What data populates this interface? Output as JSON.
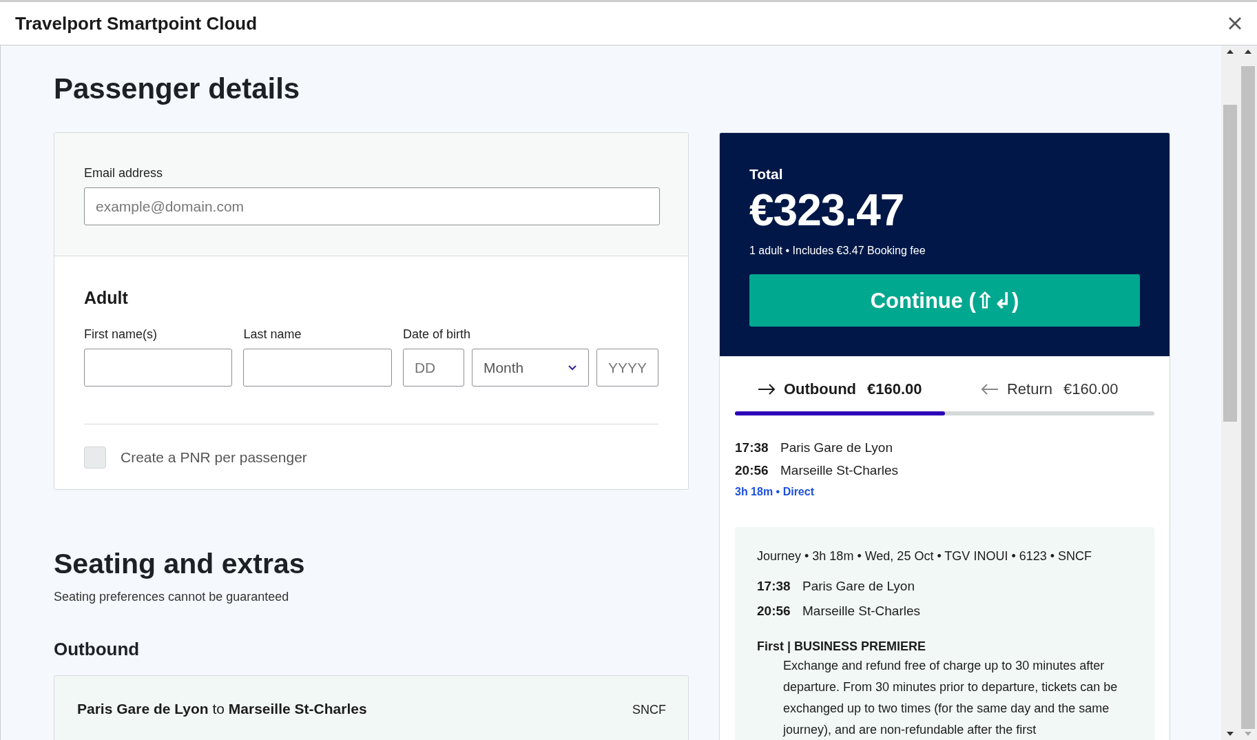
{
  "window": {
    "title": "Travelport Smartpoint Cloud"
  },
  "heading": "Passenger details",
  "email": {
    "label": "Email address",
    "placeholder": "example@domain.com"
  },
  "passenger": {
    "heading": "Adult",
    "fields": [
      {
        "kind": "text",
        "label": "First name(s)"
      },
      {
        "kind": "text",
        "label": "Last name"
      },
      {
        "kind": "date",
        "label": "Date of birth",
        "parts": [
          {
            "kind": "input",
            "placeholder": "DD"
          },
          {
            "kind": "select",
            "placeholder": "Month"
          },
          {
            "kind": "input",
            "placeholder": "YYYY"
          }
        ]
      }
    ]
  },
  "pnr_option": {
    "label": "Create a PNR per passenger",
    "checked": false
  },
  "seating": {
    "heading": "Seating and extras",
    "note": "Seating preferences cannot be guaranteed",
    "subheading": "Outbound",
    "route": "**Paris Gare de Lyon** to **Marseille St-Charles**",
    "operator": "SNCF"
  },
  "summary": {
    "label": "Total",
    "price": "€323.47",
    "detail": "1 adult • Includes €3.47 Booking fee",
    "button": "Continue (⇧↲)"
  },
  "tabs": [
    {
      "kind": "outbound",
      "label": "Outbound",
      "price": "€160.00",
      "selected": true
    },
    {
      "kind": "return",
      "label": "Return",
      "price": "€160.00",
      "selected": false
    }
  ],
  "tab_progress": {
    "level": 0.5
  },
  "stops": [
    {
      "time": "17:38",
      "station": "Paris Gare de Lyon"
    },
    {
      "time": "20:56",
      "station": "Marseille St-Charles"
    }
  ],
  "duration": "3h 18m • Direct",
  "journey": {
    "summary": "Journey • 3h 18m • Wed, 25 Oct • TGV INOUI • 6123 • SNCF",
    "stops": [
      {
        "time": "17:38",
        "station": "Paris Gare de Lyon"
      },
      {
        "time": "20:56",
        "station": "Marseille St-Charles"
      }
    ],
    "fare_class": "First | BUSINESS PREMIERE",
    "conditions": "Exchange and refund free of charge up to 30 minutes after departure. From 30 minutes prior to departure, tickets can be exchanged up to two times (for the same day and the same journey), and are non-refundable after the first"
  }
}
